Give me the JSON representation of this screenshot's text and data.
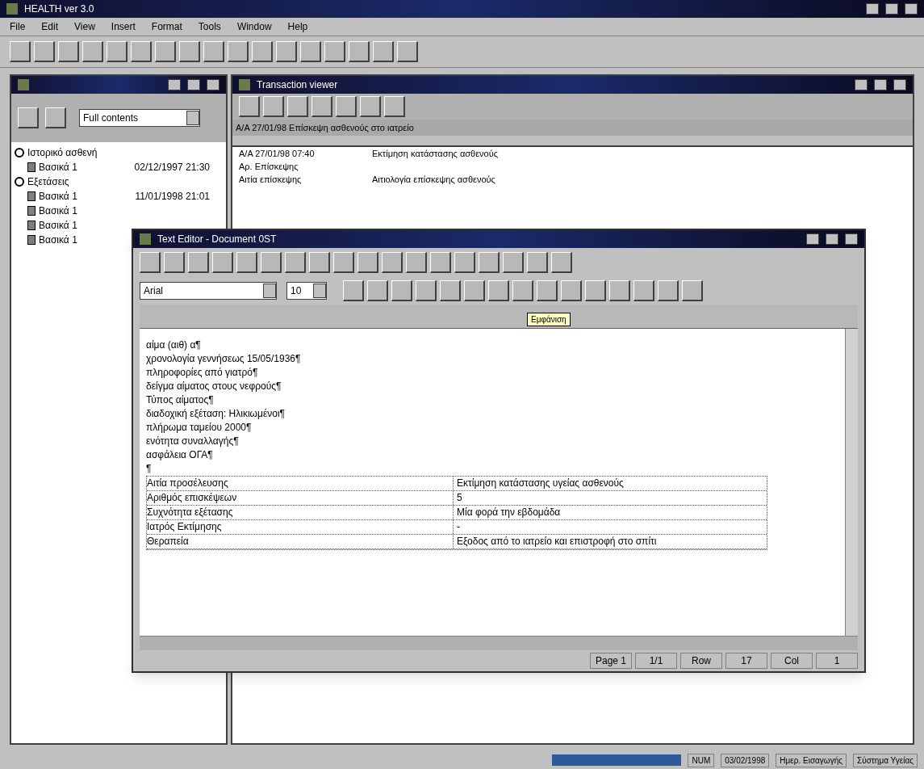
{
  "window": {
    "title": "HEALTH ver 3.0"
  },
  "menu": [
    "File",
    "Edit",
    "View",
    "Insert",
    "Format",
    "Tools",
    "Window",
    "Help"
  ],
  "explorer": {
    "combo_value": "Full contents",
    "tree": [
      {
        "label": "Ιστορικό ασθενή",
        "expanded": true,
        "children": [
          {
            "label": "Βασικά 1",
            "date": "02/12/1997 21:30"
          }
        ]
      },
      {
        "label": "Εξετάσεις",
        "expanded": true,
        "children": [
          {
            "label": "Βασικά 1",
            "date": "11/01/1998 21:01"
          },
          {
            "label": "Βασικά 1"
          },
          {
            "label": "Βασικά 1"
          },
          {
            "label": "Βασικά 1"
          }
        ]
      }
    ]
  },
  "transaction_viewer": {
    "title": "Transaction viewer",
    "header": "Α/Α 27/01/98 Επίσκεψη ασθενούς στο ιατρείο",
    "rows": [
      {
        "column_1": "Α/Α 27/01/98 07:40",
        "column_2": "Εκτίμηση κατάστασης ασθενούς"
      },
      {
        "column_1": "Αρ. Επίσκεψης"
      },
      {
        "column_1": "Αιτία επίσκεψης",
        "column_2": "Αιτιολογία επίσκεψης ασθενούς"
      }
    ]
  },
  "text_editor": {
    "title": "Text Editor - Document 0ST",
    "font": "Arial",
    "size": "10",
    "tooltip": "Εμφάνιση",
    "lines": [
      "αίμα (αιθ) α¶",
      "χρονολογία γεννήσεως 15/05/1936¶",
      "πληροφορίες από γιατρό¶",
      "δείγμα αίματος στους νεφρούς¶",
      "Τύπος αίματος¶",
      "διαδοχική εξέταση: Ηλικιωμένοι¶",
      "πλήρωμα ταμείου 2000¶",
      "ενότητα συναλλαγής¶",
      "ασφάλεια ΟΓΑ¶",
      "¶"
    ],
    "table": [
      {
        "label": "Αιτία προσέλευσης",
        "value": "Εκτίμηση κατάστασης υγείας ασθενούς"
      },
      {
        "label": "Αριθμός επισκέψεων",
        "value": "5"
      },
      {
        "label": "Συχνότητα εξέτασης",
        "value": "Μία φορά την εβδομάδα"
      },
      {
        "label": "Ιατρός Εκτίμησης",
        "value": "-"
      },
      {
        "label": "Θεραπεία",
        "value": "Εξοδος από το ιατρείο και επιστροφή στο σπίτι"
      }
    ],
    "status": [
      "Page 1",
      "1/1",
      "Row",
      "17",
      "Col",
      "1"
    ]
  },
  "status_bar": {
    "progress": {
      "level": 1
    },
    "fields": [
      "NUM",
      "03/02/1998",
      "Ημερ. Εισαγωγής",
      "Σύστημα Υγείας"
    ]
  }
}
